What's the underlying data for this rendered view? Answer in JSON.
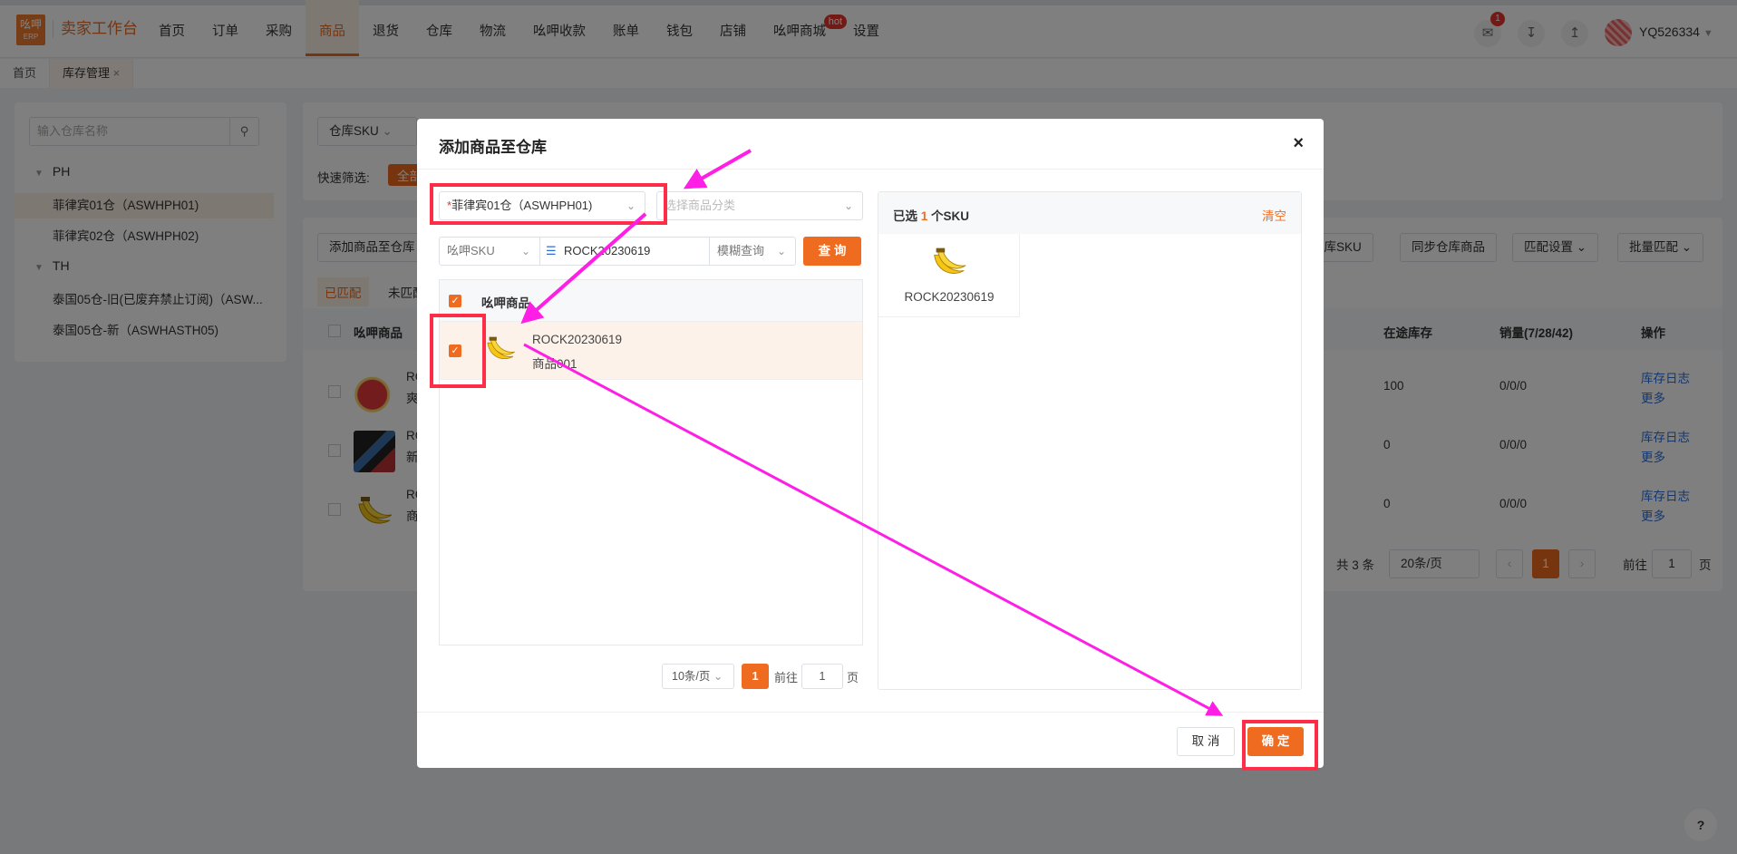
{
  "nav": {
    "logo_top": "吆呷",
    "logo_bottom": "ERP",
    "brand": "卖家工作台",
    "items": [
      "首页",
      "订单",
      "采购",
      "商品",
      "退货",
      "仓库",
      "物流",
      "吆呷收款",
      "账单",
      "钱包",
      "店铺",
      "吆呷商城",
      "设置"
    ],
    "hot_badge": "hot",
    "notify_count": "1",
    "username": "YQ526334"
  },
  "page_tabs": {
    "home": "首页",
    "inventory": "库存管理",
    "close": "×"
  },
  "left": {
    "search_placeholder": "输入仓库名称",
    "groups": [
      {
        "name": "PH",
        "items": [
          "菲律宾01仓（ASWHPH01)",
          "菲律宾02仓（ASWHPH02)"
        ]
      },
      {
        "name": "TH",
        "items": [
          "泰国05仓-旧(已废弃禁止订阅)（ASW...",
          "泰国05仓-新（ASWHASTH05)"
        ]
      }
    ]
  },
  "bg": {
    "sku_select": "仓库SKU",
    "quick_filter": "快速筛选:",
    "quick_all": "全部",
    "add_btn": "添加商品至仓库",
    "warehouse_sku_btn": "仓库SKU",
    "sync_btn": "同步仓库商品",
    "match_settings": "匹配设置",
    "batch_match": "批量匹配",
    "tab_matched": "已匹配",
    "tab_unmatched": "未匹配",
    "col_product": "吆呷商品",
    "col_transit": "在途库存",
    "col_sales": "销量(7/28/42)",
    "col_action": "操作",
    "rows": [
      {
        "code": "RC",
        "name": "爽",
        "transit": "100",
        "sales": "0/0/0"
      },
      {
        "code": "RC",
        "name": "新",
        "transit": "0",
        "sales": "0/0/0"
      },
      {
        "code": "RC",
        "name": "商",
        "transit": "0",
        "sales": "0/0/0"
      }
    ],
    "action_log": "库存日志",
    "action_more": "更多",
    "total": "共 3 条",
    "page_size": "20条/页",
    "page_current": "1",
    "goto": "前往",
    "goto_value": "1",
    "page_unit": "页"
  },
  "dialog": {
    "title": "添加商品至仓库",
    "close": "×",
    "warehouse_required": "*",
    "warehouse_value": "菲律宾01仓（ASWHPH01)",
    "category_placeholder": "选择商品分类",
    "sku_type": "吆呷SKU",
    "search_value": "ROCK20230619",
    "match_mode": "模糊查询",
    "query_btn": "查 询",
    "list_header": "吆呷商品",
    "item": {
      "sku": "ROCK20230619",
      "name": "商品001"
    },
    "page_size": "10条/页",
    "page_current": "1",
    "goto": "前往",
    "goto_value": "1",
    "page_unit": "页",
    "selected_prefix": "已选",
    "selected_count": "1",
    "selected_suffix": "个SKU",
    "clear": "清空",
    "selected_item_sku": "ROCK20230619",
    "cancel": "取 消",
    "confirm": "确 定"
  },
  "help": "?"
}
